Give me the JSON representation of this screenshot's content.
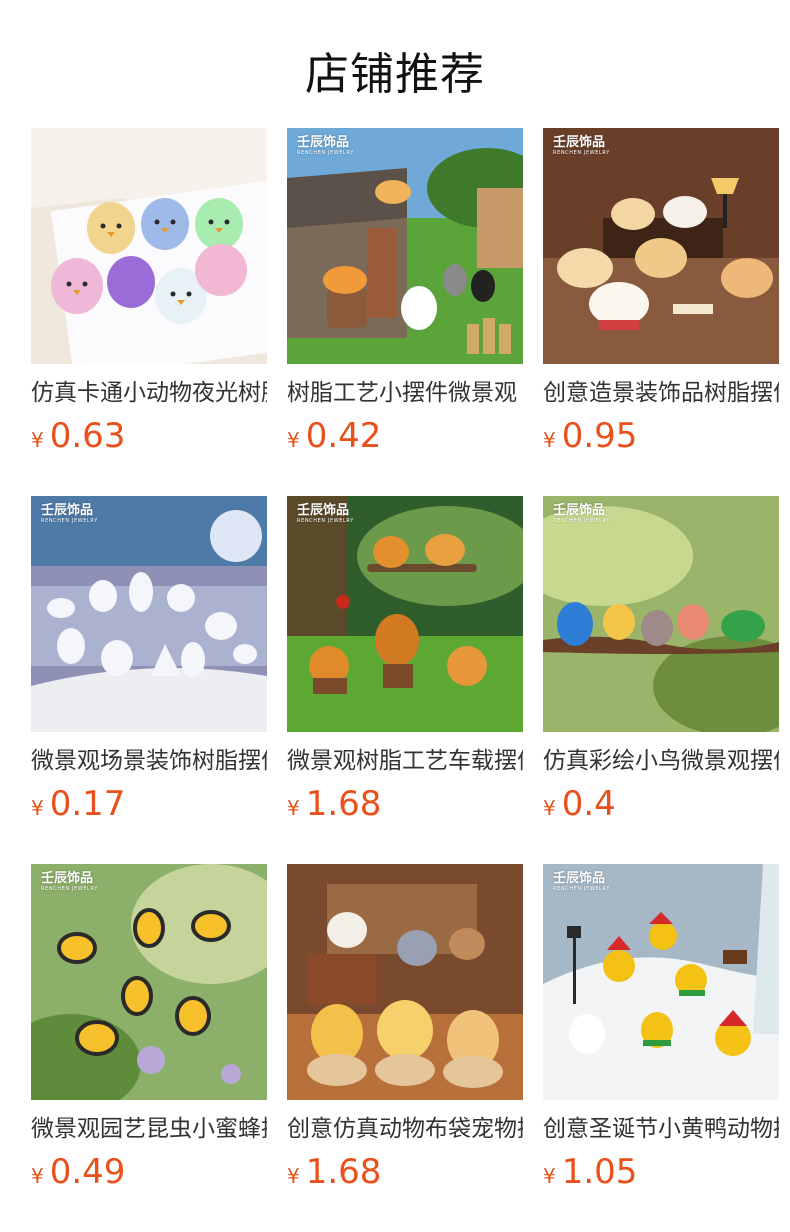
{
  "section_title": "店铺推荐",
  "colors": {
    "price": "#e8501c",
    "text": "#333333"
  },
  "currency_symbol": "¥",
  "products": [
    {
      "name": "仿真卡通小动物夜光树脂摆件",
      "price": "0.63",
      "brand": "",
      "brand_sub": "",
      "image": "glowing-cartoon-chicks"
    },
    {
      "name": "树脂工艺小摆件微景观",
      "price": "0.42",
      "brand": "壬辰饰品",
      "brand_sub": "RENCHEN JEWELRY",
      "image": "resin-cats-and-cottage"
    },
    {
      "name": "创意造景装饰品树脂摆件",
      "price": "0.95",
      "brand": "壬辰饰品",
      "brand_sub": "RENCHEN JEWELRY",
      "image": "sleeping-puppies"
    },
    {
      "name": "微景观场景装饰树脂摆件",
      "price": "0.17",
      "brand": "壬辰饰品",
      "brand_sub": "RENCHEN JEWELRY",
      "image": "glowing-polar-animals"
    },
    {
      "name": "微景观树脂工艺车载摆件",
      "price": "1.68",
      "brand": "壬辰饰品",
      "brand_sub": "RENCHEN JEWELRY",
      "image": "squirrels-in-forest"
    },
    {
      "name": "仿真彩绘小鸟微景观摆件",
      "price": "0.4",
      "brand": "壬辰饰品",
      "brand_sub": "RENCHEN JEWELRY",
      "image": "painted-birds-on-branch"
    },
    {
      "name": "微景观园艺昆虫小蜜蜂摆件",
      "price": "0.49",
      "brand": "壬辰饰品",
      "brand_sub": "RENCHEN JEWELRY",
      "image": "cartoon-bees"
    },
    {
      "name": "创意仿真动物布袋宠物摆件",
      "price": "1.68",
      "brand": "",
      "brand_sub": "",
      "image": "animals-in-sacks"
    },
    {
      "name": "创意圣诞节小黄鸭动物摆件",
      "price": "1.05",
      "brand": "壬辰饰品",
      "brand_sub": "RENCHEN JEWELRY",
      "image": "christmas-ducks-in-snow"
    }
  ]
}
